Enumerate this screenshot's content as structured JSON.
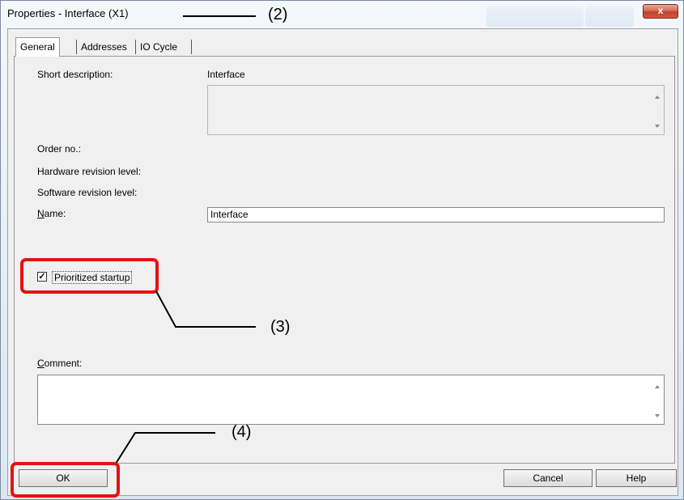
{
  "window": {
    "title": "Properties - Interface (X1)",
    "close_glyph": "x"
  },
  "tabs": [
    {
      "label": "General"
    },
    {
      "label": "Addresses"
    },
    {
      "label": "IO Cycle"
    }
  ],
  "general": {
    "short_description_label": "Short description:",
    "short_description_value": "Interface",
    "order_no_label": "Order no.:",
    "hw_revision_label": "Hardware revision level:",
    "sw_revision_label": "Software revision level:",
    "name_label_prefix": "N",
    "name_label_rest": "ame:",
    "name_value": "Interface",
    "prioritized_startup_label": "Prioritized startup",
    "prioritized_startup_checked": "✓",
    "comment_label_prefix": "C",
    "comment_label_rest": "omment:",
    "comment_value": ""
  },
  "buttons": {
    "ok": "OK",
    "cancel": "Cancel",
    "help": "Help"
  },
  "annotations": {
    "a2": "(2)",
    "a3": "(3)",
    "a4": "(4)"
  },
  "colors": {
    "highlight": "#e31212"
  }
}
